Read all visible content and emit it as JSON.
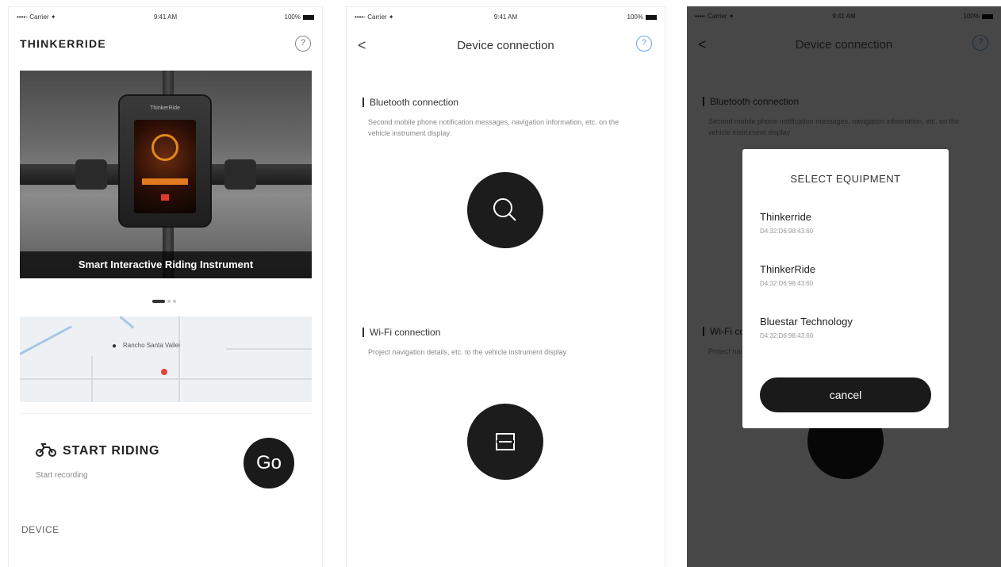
{
  "status_bar": {
    "carrier": "••••◦ Carrier ✦",
    "time": "9:41 AM",
    "battery": "100%"
  },
  "home": {
    "brand": "THINKERRIDE",
    "help_glyph": "?",
    "device_brand": "ThinkerRide",
    "banner_caption": "Smart Interactive Riding Instrument",
    "map_label": "Rancho Santa Vallei",
    "ride_title": "START RIDING",
    "ride_subtitle": "Start recording",
    "go_label": "Go",
    "section_device": "DEVICE"
  },
  "connection": {
    "title": "Device connection",
    "back_glyph": "<",
    "help_glyph": "?",
    "bluetooth_title": "Bluetooth connection",
    "bluetooth_desc": "Second mobile phone notification messages, navigation information, etc. on the vehicle instrument display",
    "wifi_title": "Wi-Fi connection",
    "wifi_desc": "Project navigation details, etc. to the vehicle instrument display"
  },
  "select_dialog": {
    "title": "SELECT EQUIPMENT",
    "devices": [
      {
        "name": "Thinkerride",
        "mac": "D4:32:D6:98:43:60"
      },
      {
        "name": "ThinkerRide",
        "mac": "D4:32:D6:98:43:60"
      },
      {
        "name": "Bluestar Technology",
        "mac": "D4:32:D6:98:43:60"
      }
    ],
    "cancel_label": "cancel"
  },
  "icons": [
    "help-icon",
    "back-icon",
    "search-icon",
    "screen-cast-icon",
    "motorcycle-icon",
    "map-pin-icon"
  ],
  "colors": {
    "accent_dark": "#1a1a1a",
    "help_blue": "#6da2e3",
    "banner_orange": "#e47a20"
  }
}
